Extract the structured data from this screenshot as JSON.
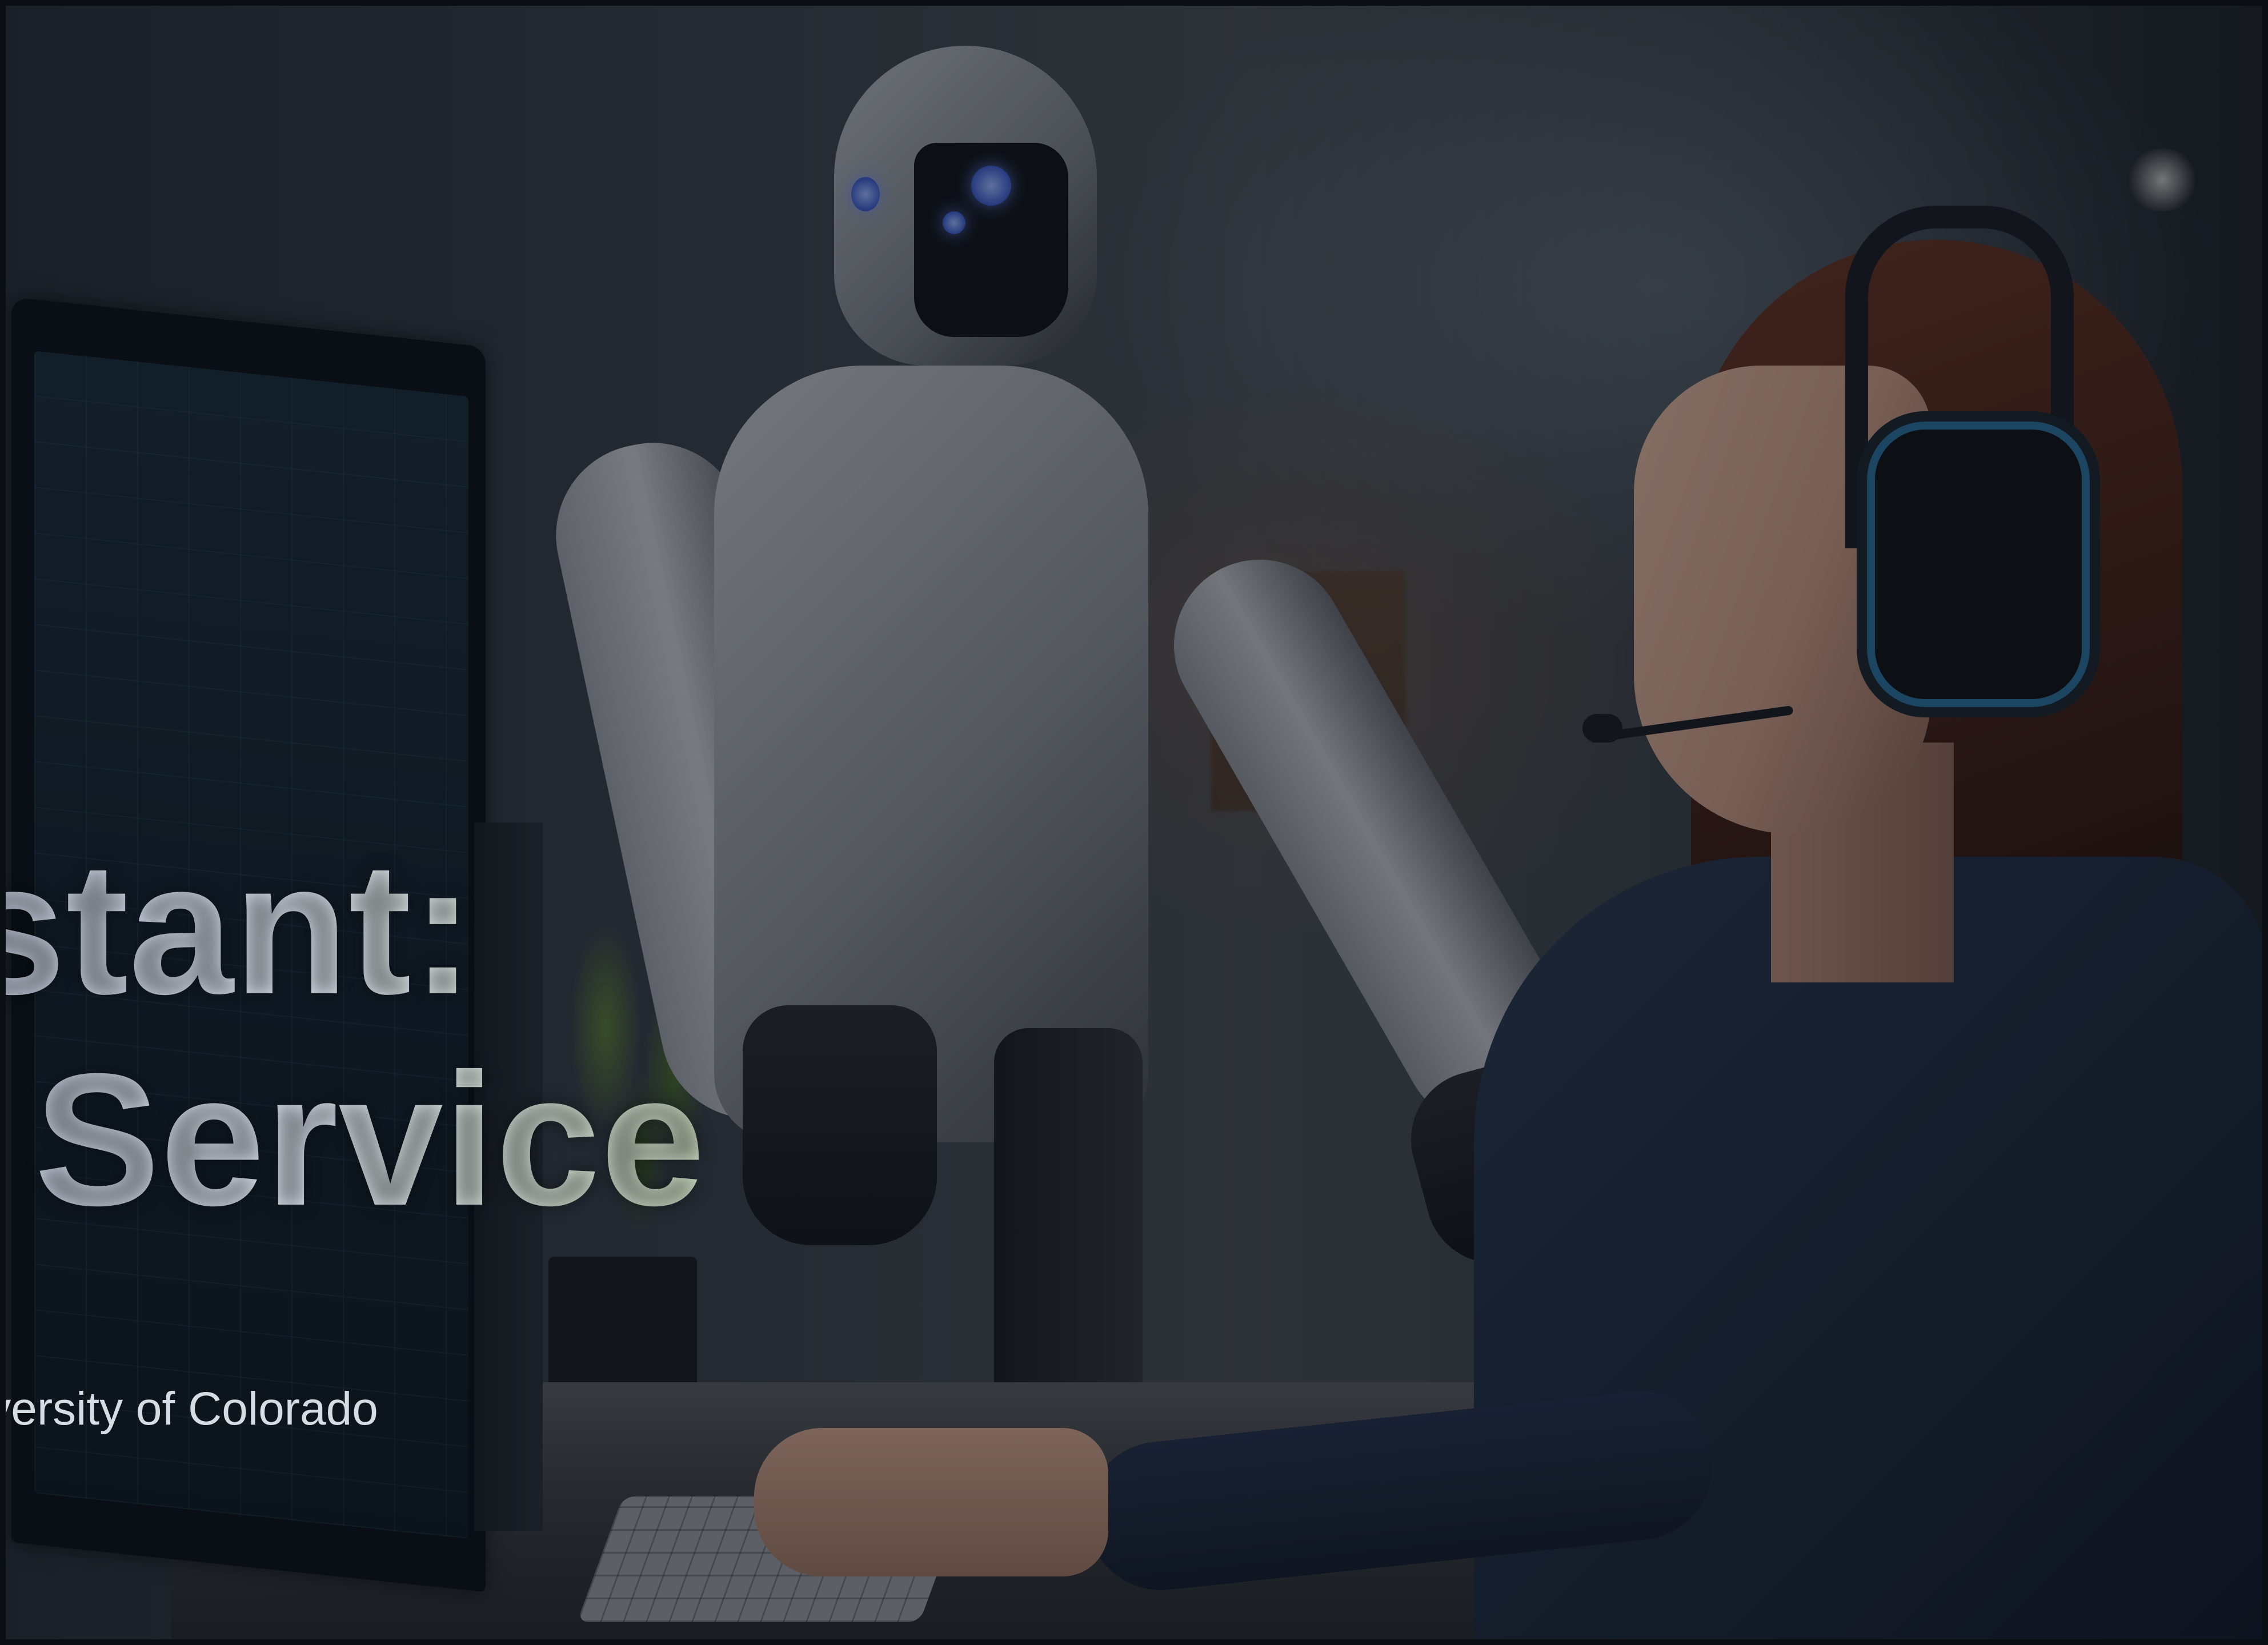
{
  "slide": {
    "title_line_1": "istant:",
    "title_line_2": "r Service",
    "subtitle": "iversity of Colorado"
  },
  "scene": {
    "subjects": [
      "robot",
      "woman-with-headset",
      "monitor",
      "plant",
      "keyboard"
    ]
  },
  "colors": {
    "background_dark": "#0b0f16",
    "title_text": "#c7cedb",
    "subtitle_text": "#d7dbe2",
    "headset_accent": "#2c6f9a",
    "robot_eye": "#3d5dcc"
  }
}
